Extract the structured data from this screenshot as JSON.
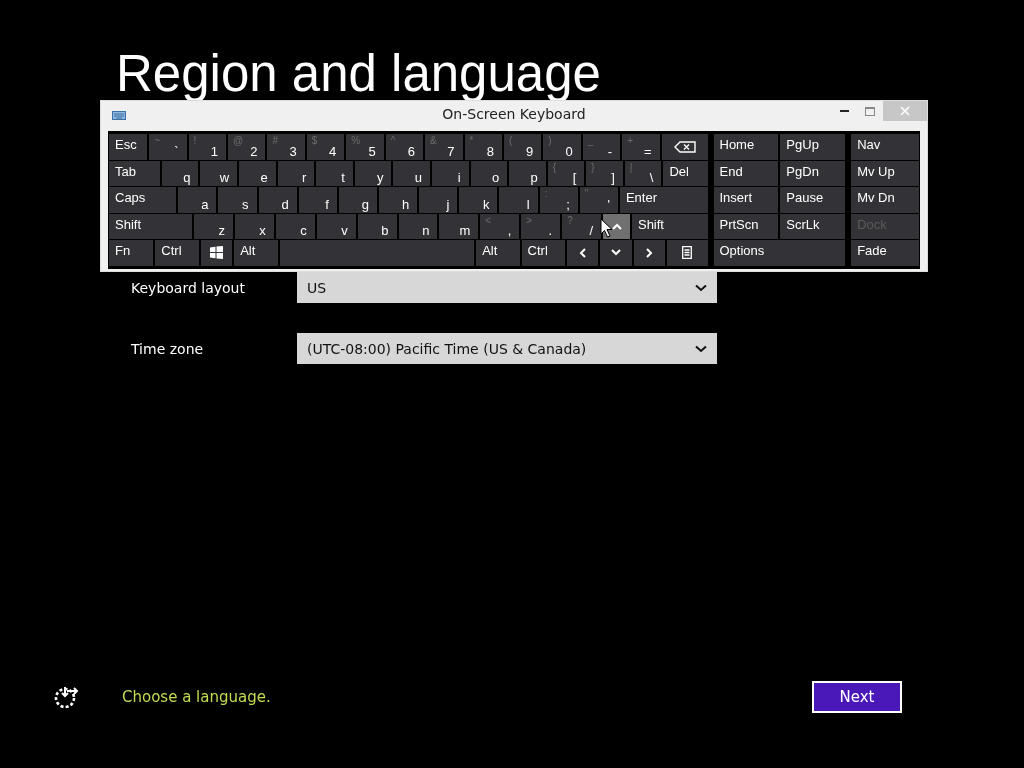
{
  "page": {
    "title": "Region and language"
  },
  "fields": [
    {
      "label": "Keyboard layout",
      "value": "US"
    },
    {
      "label": "Time zone",
      "value": "(UTC-08:00) Pacific Time (US & Canada)"
    }
  ],
  "osk": {
    "title": "On-Screen Keyboard",
    "main_rows": [
      [
        {
          "label": "Esc"
        },
        {
          "label": "`",
          "shift": "~"
        },
        {
          "label": "1",
          "shift": "!"
        },
        {
          "label": "2",
          "shift": "@"
        },
        {
          "label": "3",
          "shift": "#"
        },
        {
          "label": "4",
          "shift": "$"
        },
        {
          "label": "5",
          "shift": "%"
        },
        {
          "label": "6",
          "shift": "^"
        },
        {
          "label": "7",
          "shift": "&"
        },
        {
          "label": "8",
          "shift": "*"
        },
        {
          "label": "9",
          "shift": "("
        },
        {
          "label": "0",
          "shift": ")"
        },
        {
          "label": "-",
          "shift": "_"
        },
        {
          "label": "=",
          "shift": "+"
        },
        {
          "kind": "backspace"
        }
      ],
      [
        {
          "label": "Tab"
        },
        {
          "label": "q"
        },
        {
          "label": "w"
        },
        {
          "label": "e"
        },
        {
          "label": "r"
        },
        {
          "label": "t"
        },
        {
          "label": "y"
        },
        {
          "label": "u"
        },
        {
          "label": "i"
        },
        {
          "label": "o"
        },
        {
          "label": "p"
        },
        {
          "label": "[",
          "shift": "{"
        },
        {
          "label": "]",
          "shift": "}"
        },
        {
          "label": "\\",
          "shift": "|"
        },
        {
          "label": "Del"
        }
      ],
      [
        {
          "label": "Caps"
        },
        {
          "label": "a"
        },
        {
          "label": "s"
        },
        {
          "label": "d"
        },
        {
          "label": "f"
        },
        {
          "label": "g"
        },
        {
          "label": "h"
        },
        {
          "label": "j"
        },
        {
          "label": "k"
        },
        {
          "label": "l"
        },
        {
          "label": ";",
          "shift": ":"
        },
        {
          "label": "'",
          "shift": "\""
        },
        {
          "label": "Enter"
        }
      ],
      [
        {
          "label": "Shift"
        },
        {
          "label": "z"
        },
        {
          "label": "x"
        },
        {
          "label": "c"
        },
        {
          "label": "v"
        },
        {
          "label": "b"
        },
        {
          "label": "n"
        },
        {
          "label": "m"
        },
        {
          "label": ",",
          "shift": "<"
        },
        {
          "label": ".",
          "shift": ">"
        },
        {
          "label": "/",
          "shift": "?"
        },
        {
          "kind": "up",
          "hovered": true
        },
        {
          "label": "Shift"
        }
      ],
      [
        {
          "label": "Fn"
        },
        {
          "label": "Ctrl"
        },
        {
          "kind": "windows"
        },
        {
          "label": "Alt"
        },
        {
          "kind": "space"
        },
        {
          "label": "Alt"
        },
        {
          "label": "Ctrl"
        },
        {
          "kind": "left"
        },
        {
          "kind": "down"
        },
        {
          "kind": "right"
        },
        {
          "kind": "menu"
        }
      ]
    ],
    "nav_rows": [
      [
        {
          "label": "Home"
        },
        {
          "label": "PgUp"
        }
      ],
      [
        {
          "label": "End"
        },
        {
          "label": "PgDn"
        }
      ],
      [
        {
          "label": "Insert"
        },
        {
          "label": "Pause"
        }
      ],
      [
        {
          "label": "PrtScn"
        },
        {
          "label": "ScrLk"
        }
      ],
      [
        {
          "label": "Options"
        }
      ]
    ],
    "side_keys": [
      {
        "label": "Nav",
        "disabled": false
      },
      {
        "label": "Mv Up",
        "disabled": false
      },
      {
        "label": "Mv Dn",
        "disabled": false
      },
      {
        "label": "Dock",
        "disabled": true
      },
      {
        "label": "Fade",
        "disabled": false
      }
    ]
  },
  "footer": {
    "message": "Choose a language.",
    "button": "Next"
  }
}
